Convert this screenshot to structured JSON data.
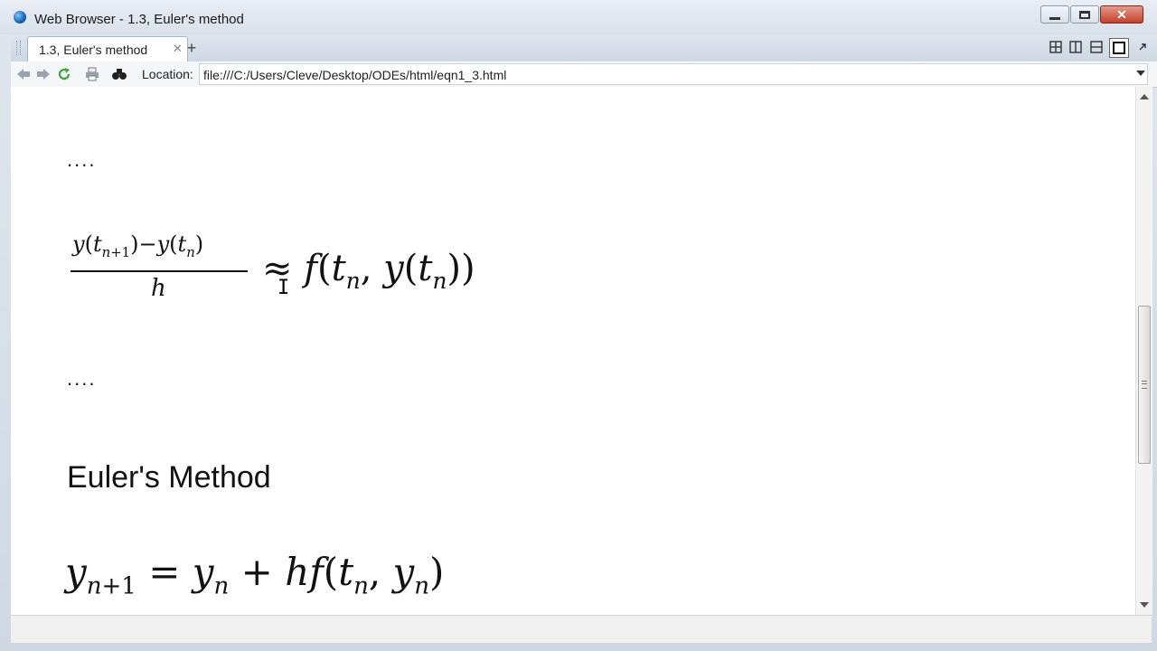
{
  "window": {
    "title": "Web Browser - 1.3, Euler's method"
  },
  "tabs": [
    {
      "label": "1.3, Euler's method"
    }
  ],
  "toolbar": {
    "location_label": "Location:",
    "location_value": "file:///C:/Users/Cleve/Desktop/ODEs/html/eqn1_3.html"
  },
  "content": {
    "ellipsis_1": "....",
    "ellipsis_2": "....",
    "heading": "Euler's Method",
    "equation_1": {
      "lhs_numerator": "y(t_{n+1}) − y(t_n)",
      "lhs_denominator": "h",
      "rhs": "≈ f(t_n, y(t_n))"
    },
    "equation_2": "y_{n+1} = y_n + h f(t_n, y_n)"
  },
  "icons": [
    "globe-icon",
    "minimize-icon",
    "maximize-icon",
    "close-icon",
    "tab-close-icon",
    "new-tab-icon",
    "layout-tile-icon",
    "layout-vertical-icon",
    "layout-horizontal-icon",
    "layout-single-icon",
    "back-icon",
    "forward-icon",
    "refresh-icon",
    "print-icon",
    "find-icon"
  ],
  "colors": {
    "accent": "#c7412b",
    "refresh": "#3aa63a"
  }
}
